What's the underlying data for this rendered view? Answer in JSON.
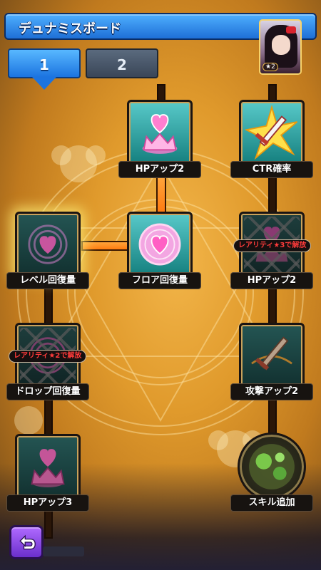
{
  "header": {
    "title": "デュナミスボード"
  },
  "character": {
    "rank": "★2"
  },
  "tabs": [
    {
      "label": "1",
      "active": true
    },
    {
      "label": "2",
      "active": false
    }
  ],
  "nodes": [
    {
      "id": "hp-up-2-top",
      "label": "HPアップ2",
      "state": "unlocked",
      "icon": "heart-crown-icon"
    },
    {
      "id": "ctr-rate",
      "label": "CTR確率",
      "state": "unlocked",
      "icon": "sword-burst-icon"
    },
    {
      "id": "level-recovery",
      "label": "レベル回復量",
      "state": "available",
      "icon": "heart-rings-icon"
    },
    {
      "id": "floor-recovery",
      "label": "フロア回復量",
      "state": "unlocked",
      "icon": "heart-rings-icon"
    },
    {
      "id": "hp-up-2-mid",
      "label": "HPアップ2",
      "state": "locked",
      "icon": "heart-crown-icon",
      "lock_text": "レアリティ★3で解放"
    },
    {
      "id": "drop-recovery",
      "label": "ドロップ回復量",
      "state": "locked",
      "icon": "heart-rings-icon",
      "lock_text": "レアリティ★2で解放"
    },
    {
      "id": "attack-up-2",
      "label": "攻撃アップ2",
      "state": "inactive",
      "icon": "sword-icon"
    },
    {
      "id": "hp-up-3",
      "label": "HPアップ3",
      "state": "inactive",
      "icon": "heart-crown-icon"
    },
    {
      "id": "skill-add",
      "label": "スキル追加",
      "state": "inactive",
      "icon": "skill-orb-icon"
    }
  ],
  "colors": {
    "header": "#1e6fd6",
    "lit_path": "#ff8a1a",
    "lock_text": "#ff3b3b"
  }
}
